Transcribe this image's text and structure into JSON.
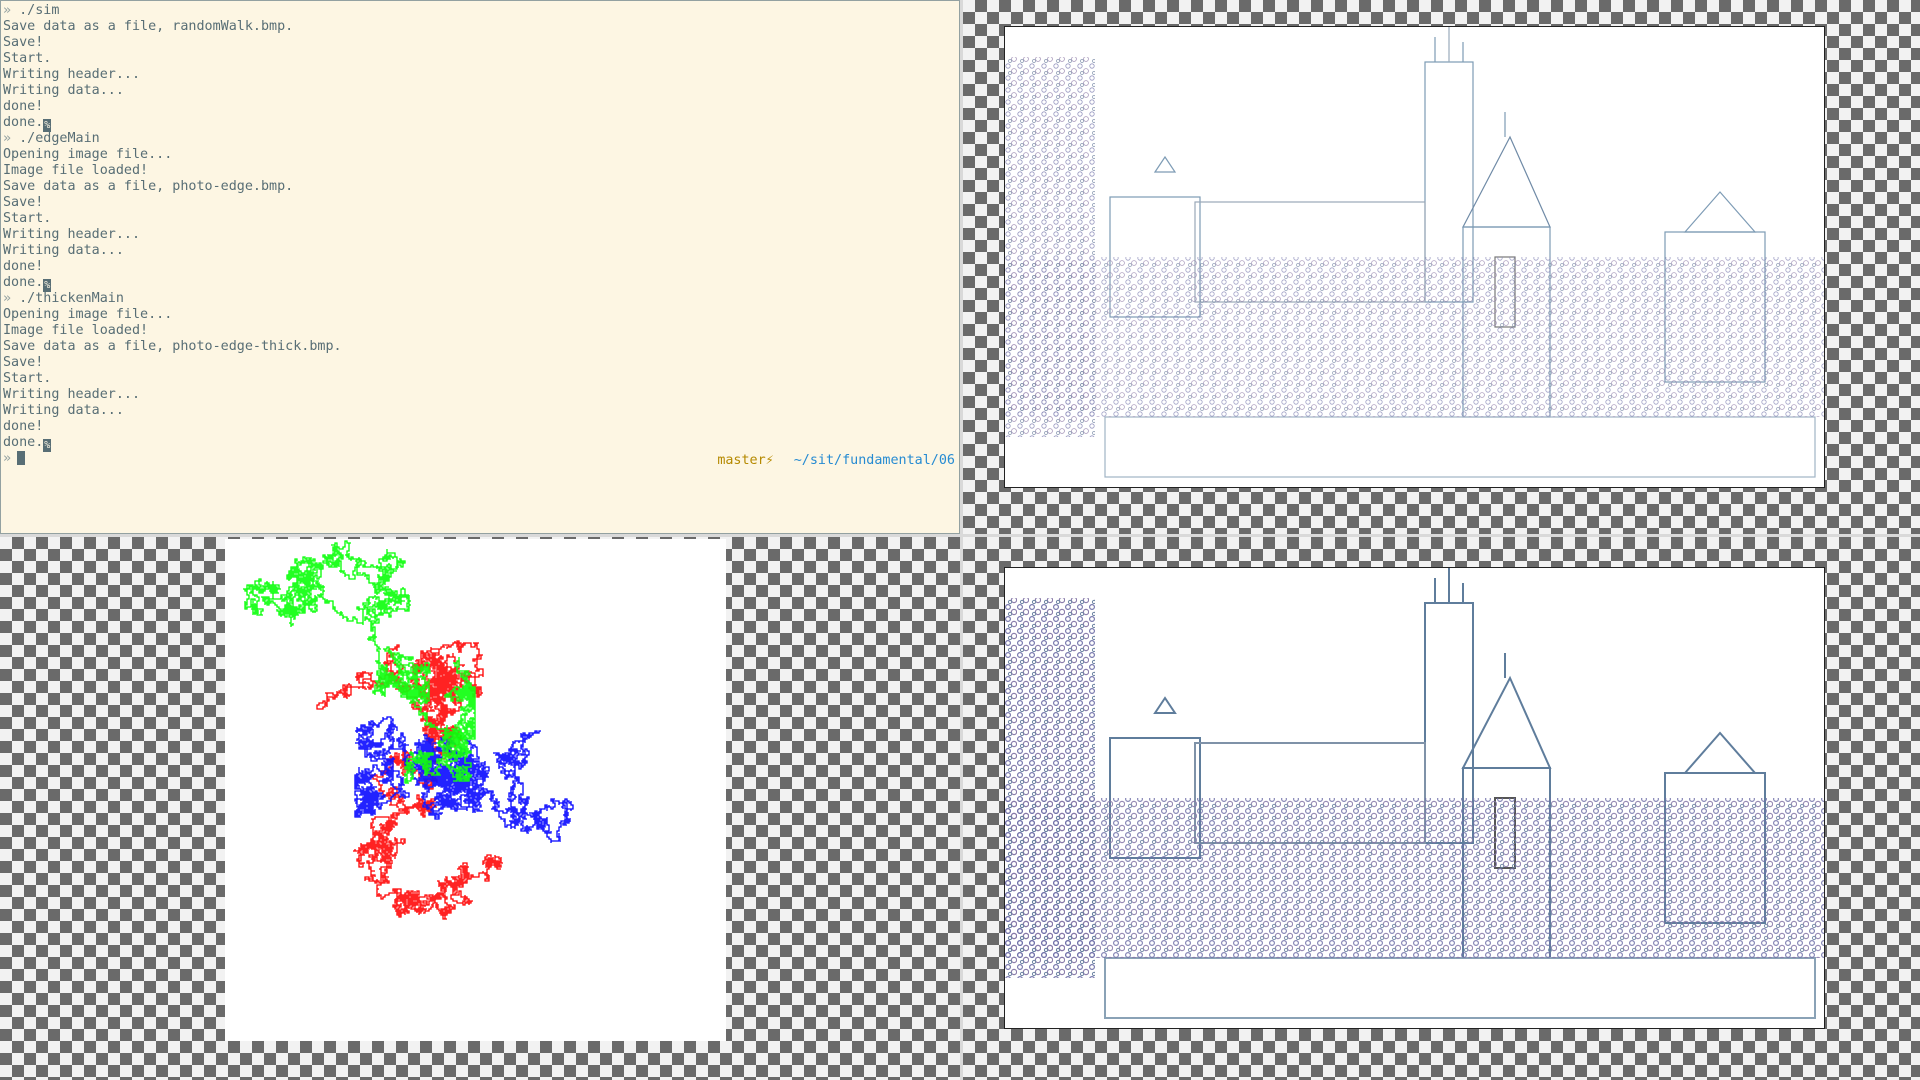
{
  "terminal": {
    "lines": [
      {
        "type": "cmd",
        "prompt": "»",
        "text": "./sim"
      },
      {
        "type": "out",
        "text": "Save data as a file, randomWalk.bmp."
      },
      {
        "type": "out",
        "text": "Save!"
      },
      {
        "type": "out",
        "text": "Start."
      },
      {
        "type": "out",
        "text": "Writing header..."
      },
      {
        "type": "out",
        "text": "Writing data..."
      },
      {
        "type": "out",
        "text": "done!"
      },
      {
        "type": "out",
        "text": "done.",
        "mark": "%"
      },
      {
        "type": "cmd",
        "prompt": "»",
        "text": "./edgeMain"
      },
      {
        "type": "out",
        "text": "Opening image file..."
      },
      {
        "type": "out",
        "text": "Image file loaded!"
      },
      {
        "type": "out",
        "text": "Save data as a file, photo-edge.bmp."
      },
      {
        "type": "out",
        "text": "Save!"
      },
      {
        "type": "out",
        "text": "Start."
      },
      {
        "type": "out",
        "text": "Writing header..."
      },
      {
        "type": "out",
        "text": "Writing data..."
      },
      {
        "type": "out",
        "text": "done!"
      },
      {
        "type": "out",
        "text": "done.",
        "mark": "%"
      },
      {
        "type": "cmd",
        "prompt": "»",
        "text": "./thickenMain"
      },
      {
        "type": "out",
        "text": "Opening image file..."
      },
      {
        "type": "out",
        "text": "Image file loaded!"
      },
      {
        "type": "out",
        "text": "Save data as a file, photo-edge-thick.bmp."
      },
      {
        "type": "out",
        "text": "Save!"
      },
      {
        "type": "out",
        "text": "Start."
      },
      {
        "type": "out",
        "text": "Writing header..."
      },
      {
        "type": "out",
        "text": "Writing data..."
      },
      {
        "type": "out",
        "text": "done!"
      },
      {
        "type": "out",
        "text": "done.",
        "mark": "%"
      }
    ],
    "final_prompt": "»",
    "right_prompt": {
      "branch": "master⚡",
      "path": "~/sit/fundamental/06"
    }
  },
  "random_walk": {
    "colors": {
      "red": "#ff0000",
      "green": "#00ff00",
      "blue": "#0000ff"
    }
  },
  "colors": {
    "terminal_bg": "#fdf6e3",
    "terminal_text": "#586e75",
    "branch": "#b58900",
    "path": "#268bd2"
  }
}
